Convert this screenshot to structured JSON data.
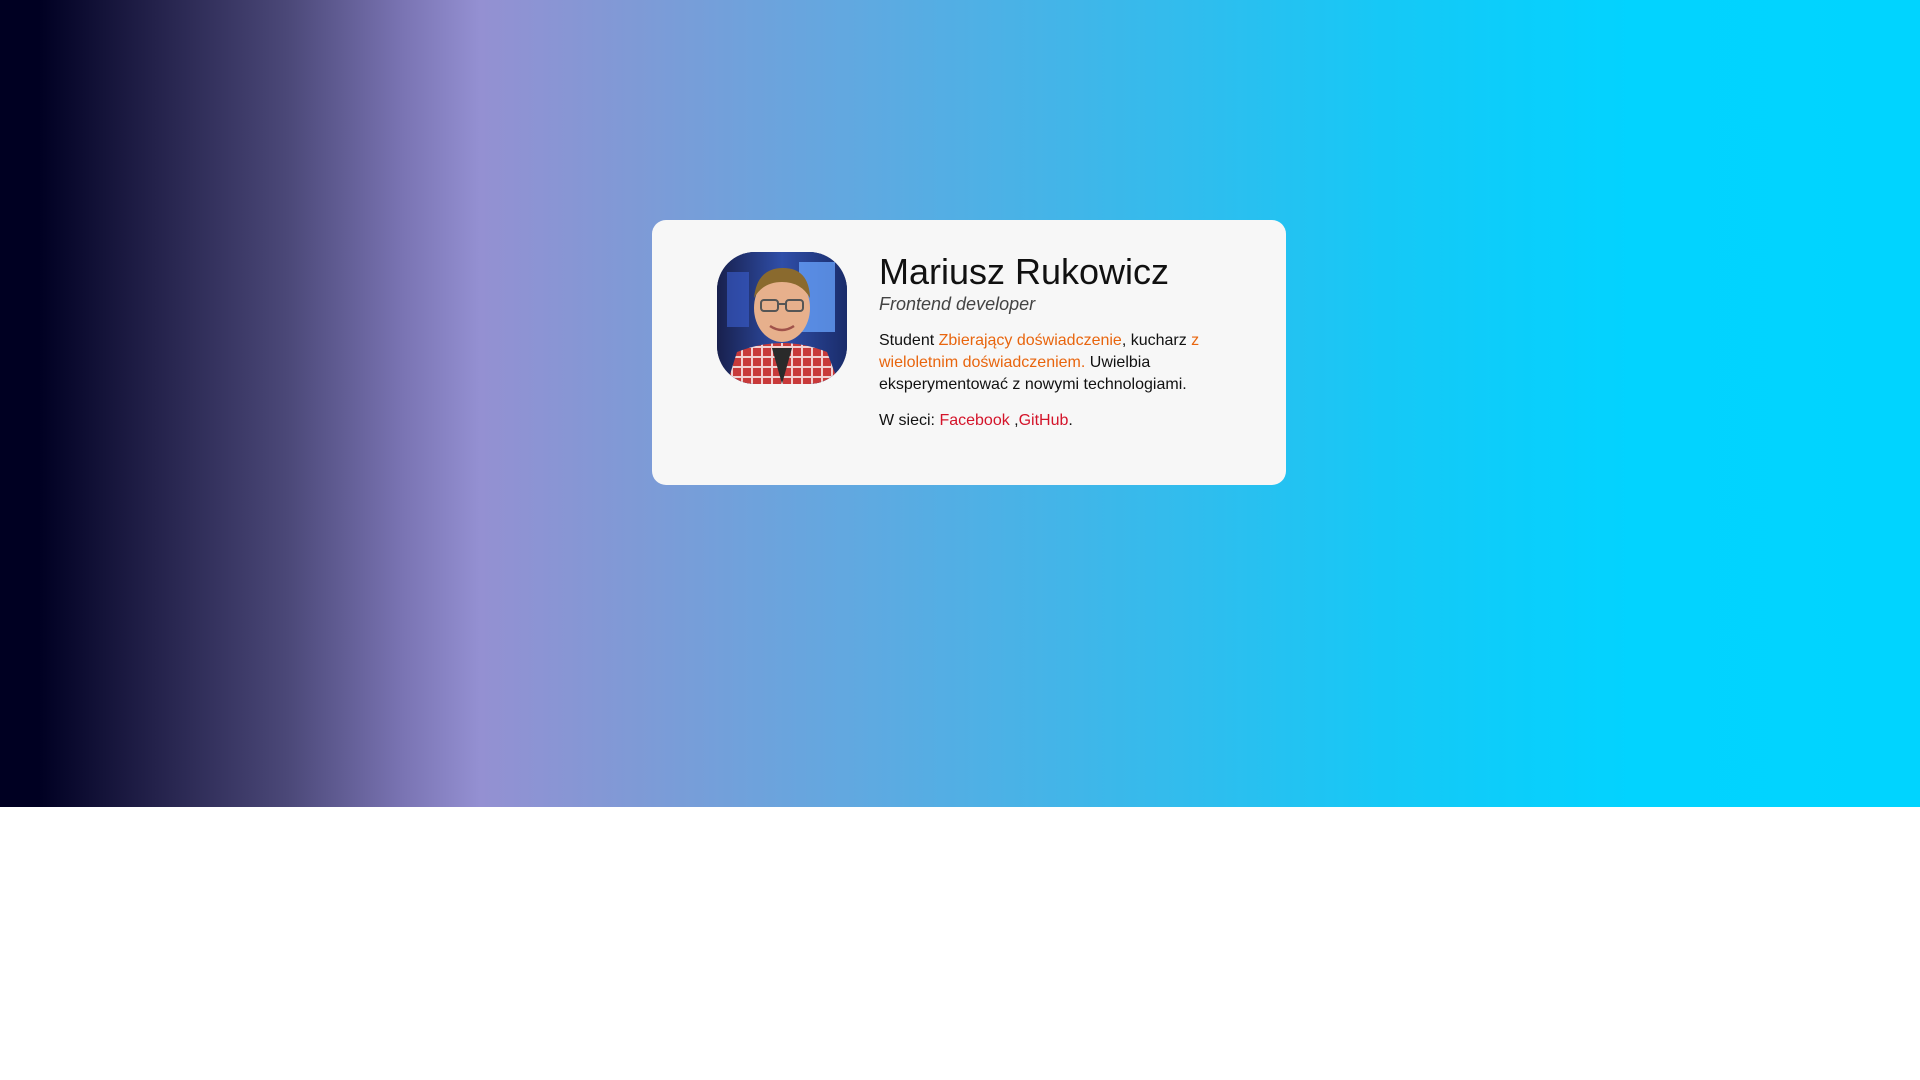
{
  "profile": {
    "name": "Mariusz Rukowicz",
    "role": "Frontend developer",
    "avatar_alt": "profile-photo"
  },
  "bio": {
    "part1": "Student ",
    "link1": "Zbierający doświadczenie",
    "part2": ", kucharz ",
    "link2": "z wieloletnim doświadczeniem.",
    "part3": " Uwielbia eksperymentować z nowymi technologiami."
  },
  "links": {
    "prefix": "W sieci: ",
    "facebook": "Facebook",
    "separator": " ,",
    "github": "GitHub",
    "suffix": "."
  },
  "colors": {
    "accent_orange": "#e8650e",
    "link_red": "#d4142a",
    "card_bg": "#f7f7f7",
    "gradient_start": "#000022",
    "gradient_mid": "#9490d2",
    "gradient_end": "#00d4ff"
  }
}
